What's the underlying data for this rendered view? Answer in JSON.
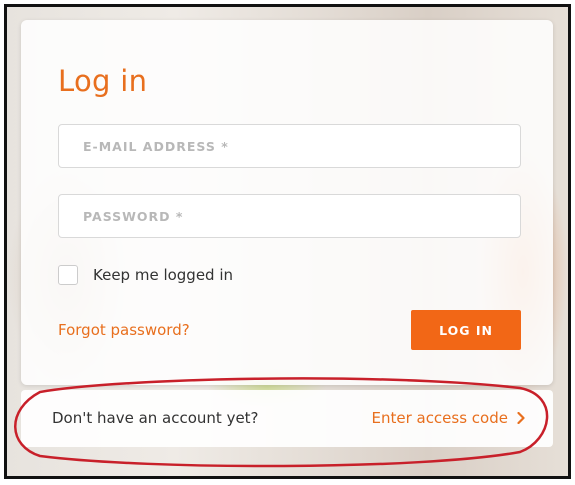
{
  "login": {
    "title": "Log in",
    "email_placeholder": "E-MAIL ADDRESS *",
    "password_placeholder": "PASSWORD *",
    "keep_logged_in_label": "Keep me logged in",
    "keep_logged_in_checked": false,
    "forgot_password_label": "Forgot password?",
    "login_button_label": "LOG IN"
  },
  "signup": {
    "prompt": "Don't have an account yet?",
    "access_code_label": "Enter access code",
    "access_code_icon": "chevron-right-icon"
  },
  "colors": {
    "accent": "#f26716",
    "accent_text": "#e86f1e",
    "annotation_circle": "#c8202a"
  }
}
